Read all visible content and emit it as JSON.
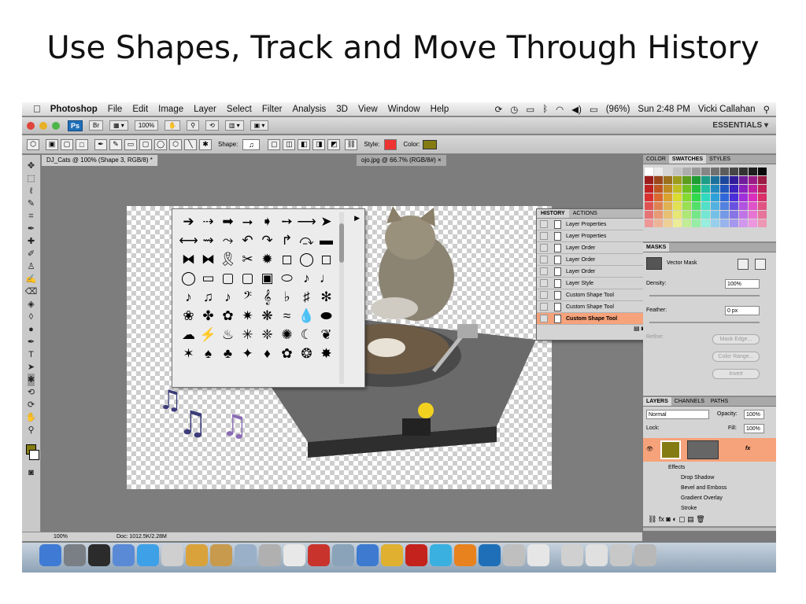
{
  "slide": {
    "title": "Use Shapes, Track and Move Through History"
  },
  "menubar": {
    "apple": "",
    "items": [
      "Photoshop",
      "File",
      "Edit",
      "Image",
      "Layer",
      "Select",
      "Filter",
      "Analysis",
      "3D",
      "View",
      "Window",
      "Help"
    ],
    "battery": "(96%)",
    "clock": "Sun 2:48 PM",
    "user": "Vicki Callahan"
  },
  "appbar": {
    "ps": "Ps",
    "br": "Br",
    "zoom": "100%",
    "workspace": "ESSENTIALS ▾"
  },
  "options": {
    "shape_label": "Shape:",
    "style_label": "Style:",
    "color_label": "Color:",
    "color_value": "#847c12"
  },
  "document": {
    "tab1": "DJ_Cats @ 100% (Shape 3, RGB/8) *",
    "tab2": "ojo.jpg @ 66.7% (RGB/8#) ×"
  },
  "shape_picker": {
    "shapes": [
      "➔",
      "⇢",
      "➡",
      "⭢",
      "➧",
      "➙",
      "⟶",
      "➤",
      "⟷",
      "⇝",
      "⤳",
      "↶",
      "↷",
      "↱",
      "⤼",
      "▬",
      "⧓",
      "⧓",
      "🎗",
      "✂",
      "✹",
      "◻",
      "◯",
      "◻",
      "◯",
      "▭",
      "▢",
      "▢",
      "▣",
      "⬭",
      "♪",
      "♩",
      "♪",
      "♫",
      "♪",
      "𝄢",
      "𝄞",
      "♭",
      "♯",
      "✻",
      "❀",
      "✤",
      "✿",
      "✷",
      "❋",
      "≈",
      "💧",
      "⬬",
      "☁",
      "⚡",
      "♨",
      "✳",
      "❈",
      "✺",
      "☾",
      "❦",
      "✶",
      "♠",
      "♣",
      "✦",
      "♦",
      "✿",
      "❂",
      "✸"
    ]
  },
  "history": {
    "tab_history": "HISTORY",
    "tab_actions": "ACTIONS",
    "items": [
      {
        "label": "Layer Properties"
      },
      {
        "label": "Layer Properties"
      },
      {
        "label": "Layer Order"
      },
      {
        "label": "Layer Order"
      },
      {
        "label": "Layer Order"
      },
      {
        "label": "Layer Style"
      },
      {
        "label": "Custom Shape Tool"
      },
      {
        "label": "Custom Shape Tool"
      },
      {
        "label": "Custom Shape Tool"
      }
    ],
    "selected_index": 8
  },
  "swatches_panel": {
    "tab_color": "COLOR",
    "tab_swatches": "SWATCHES",
    "tab_styles": "STYLES"
  },
  "masks": {
    "title": "MASKS",
    "vector_mask": "Vector Mask",
    "density_label": "Density:",
    "density_value": "100%",
    "feather_label": "Feather:",
    "feather_value": "0 px",
    "refine_label": "Refine:",
    "mask_edge": "Mask Edge...",
    "color_range": "Color Range...",
    "invert": "Invert"
  },
  "layers": {
    "tab_layers": "LAYERS",
    "tab_channels": "CHANNELS",
    "tab_paths": "PATHS",
    "blend_mode": "Normal",
    "opacity_label": "Opacity:",
    "opacity_value": "100%",
    "lock_label": "Lock:",
    "fill_label": "Fill:",
    "fill_value": "100%",
    "fx": "fx",
    "effects_label": "Effects",
    "effects": [
      "Drop Shadow",
      "Bevel and Emboss",
      "Gradient Overlay",
      "Stroke"
    ]
  },
  "status": {
    "zoom": "100%",
    "doc": "Doc: 1012.5K/2.28M"
  }
}
